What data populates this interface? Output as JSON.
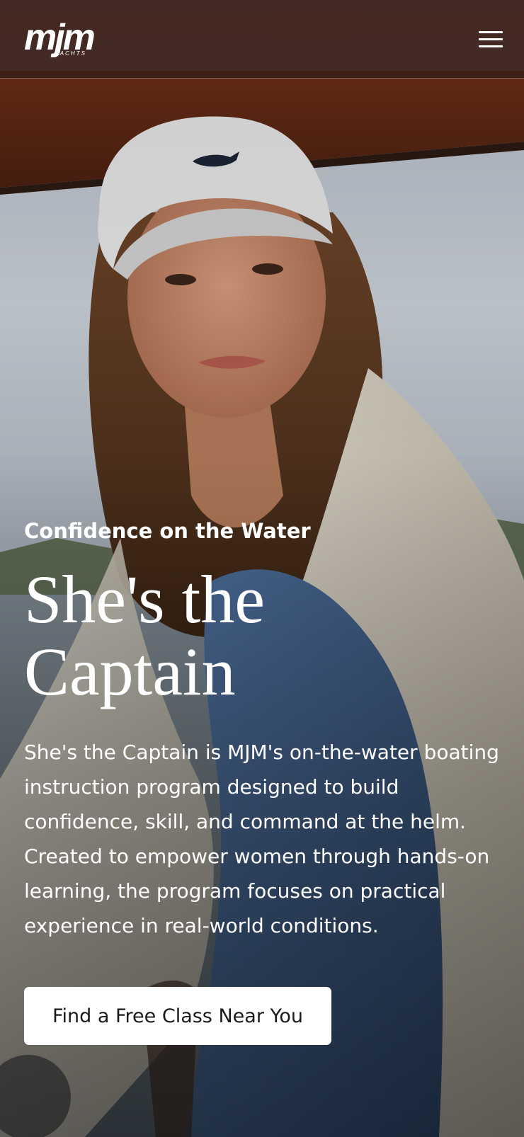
{
  "header": {
    "logo_text": "mjm",
    "logo_subtext": "YACHTS",
    "menu_icon": "hamburger-menu-icon"
  },
  "hero": {
    "eyebrow": "Confidence on the Water",
    "title_line1": "She's the",
    "title_line2": "Captain",
    "description": "She's the Captain is MJM's on-the-water boating instruction program designed to build confidence, skill, and command at the helm. Created to empower women through hands-on learning, the program focuses on practical experience in real-world conditions.",
    "cta_label": "Find a Free Class Near You"
  },
  "colors": {
    "header_bg": "#3a1c14",
    "text": "#ffffff",
    "button_bg": "#ffffff",
    "button_text": "#1a1a1a"
  }
}
